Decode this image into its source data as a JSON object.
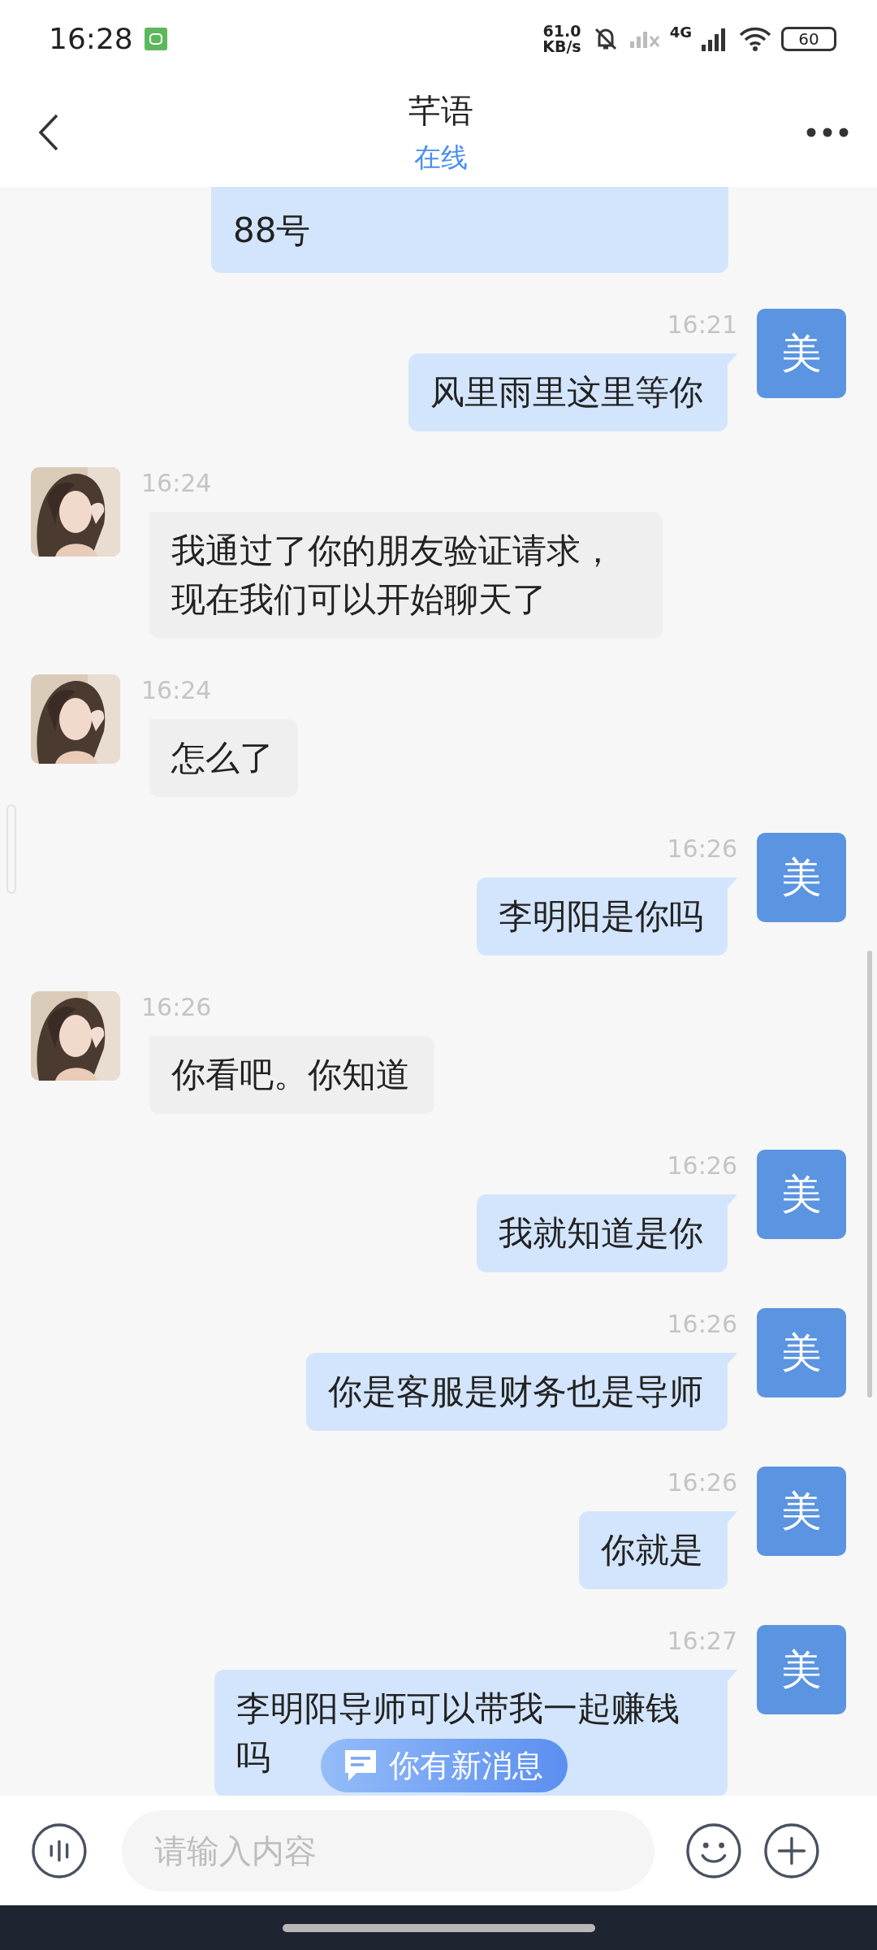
{
  "status_bar": {
    "time": "16:28",
    "net_speed": "61.0",
    "net_unit": "KB/s",
    "network": "4G",
    "battery": "60"
  },
  "header": {
    "title": "芊语",
    "status": "在线"
  },
  "messages": [
    {
      "outgoing": true,
      "kind": "cut",
      "text": "88号"
    },
    {
      "outgoing": true,
      "kind": "text",
      "time": "16:21",
      "avatar": "美",
      "text": "风里雨里这里等你"
    },
    {
      "outgoing": false,
      "kind": "text",
      "time": "16:24",
      "text": "我通过了你的朋友验证请求，现在我们可以开始聊天了"
    },
    {
      "outgoing": false,
      "kind": "text",
      "time": "16:24",
      "text": "怎么了"
    },
    {
      "outgoing": true,
      "kind": "text",
      "time": "16:26",
      "avatar": "美",
      "text": "李明阳是你吗"
    },
    {
      "outgoing": false,
      "kind": "text",
      "time": "16:26",
      "text": "你看吧。你知道"
    },
    {
      "outgoing": true,
      "kind": "text",
      "time": "16:26",
      "avatar": "美",
      "text": "我就知道是你"
    },
    {
      "outgoing": true,
      "kind": "text",
      "time": "16:26",
      "avatar": "美",
      "text": "你是客服是财务也是导师"
    },
    {
      "outgoing": true,
      "kind": "text",
      "time": "16:26",
      "avatar": "美",
      "text": "你就是"
    },
    {
      "outgoing": true,
      "kind": "text",
      "time": "16:27",
      "avatar": "美",
      "text": "李明阳导师可以带我一起赚钱吗"
    }
  ],
  "new_message_pill": {
    "label": "你有新消息"
  },
  "composer": {
    "placeholder": "请输入内容"
  }
}
